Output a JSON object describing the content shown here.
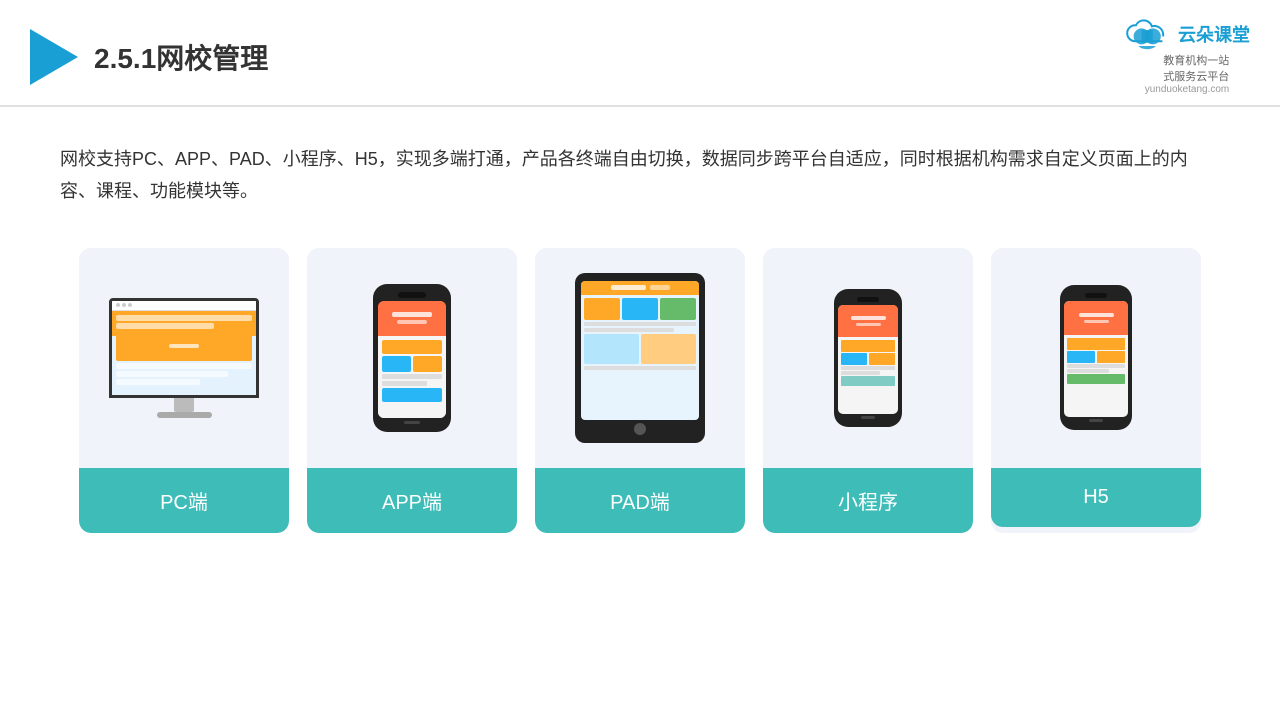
{
  "header": {
    "title": "2.5.1网校管理",
    "brand_name": "云朵课堂",
    "brand_url": "yunduoketang.com",
    "brand_subtitle_line1": "教育机构一站",
    "brand_subtitle_line2": "式服务云平台"
  },
  "description": {
    "text": "网校支持PC、APP、PAD、小程序、H5，实现多端打通，产品各终端自由切换，数据同步跨平台自适应，同时根据机构需求自定义页面上的内容、课程、功能模块等。"
  },
  "cards": [
    {
      "id": "pc",
      "label": "PC端"
    },
    {
      "id": "app",
      "label": "APP端"
    },
    {
      "id": "pad",
      "label": "PAD端"
    },
    {
      "id": "mini",
      "label": "小程序"
    },
    {
      "id": "h5",
      "label": "H5"
    }
  ],
  "colors": {
    "teal": "#3dbcb8",
    "blue_accent": "#1a9fd4",
    "text_dark": "#333333",
    "bg_card": "#eef2f8"
  }
}
